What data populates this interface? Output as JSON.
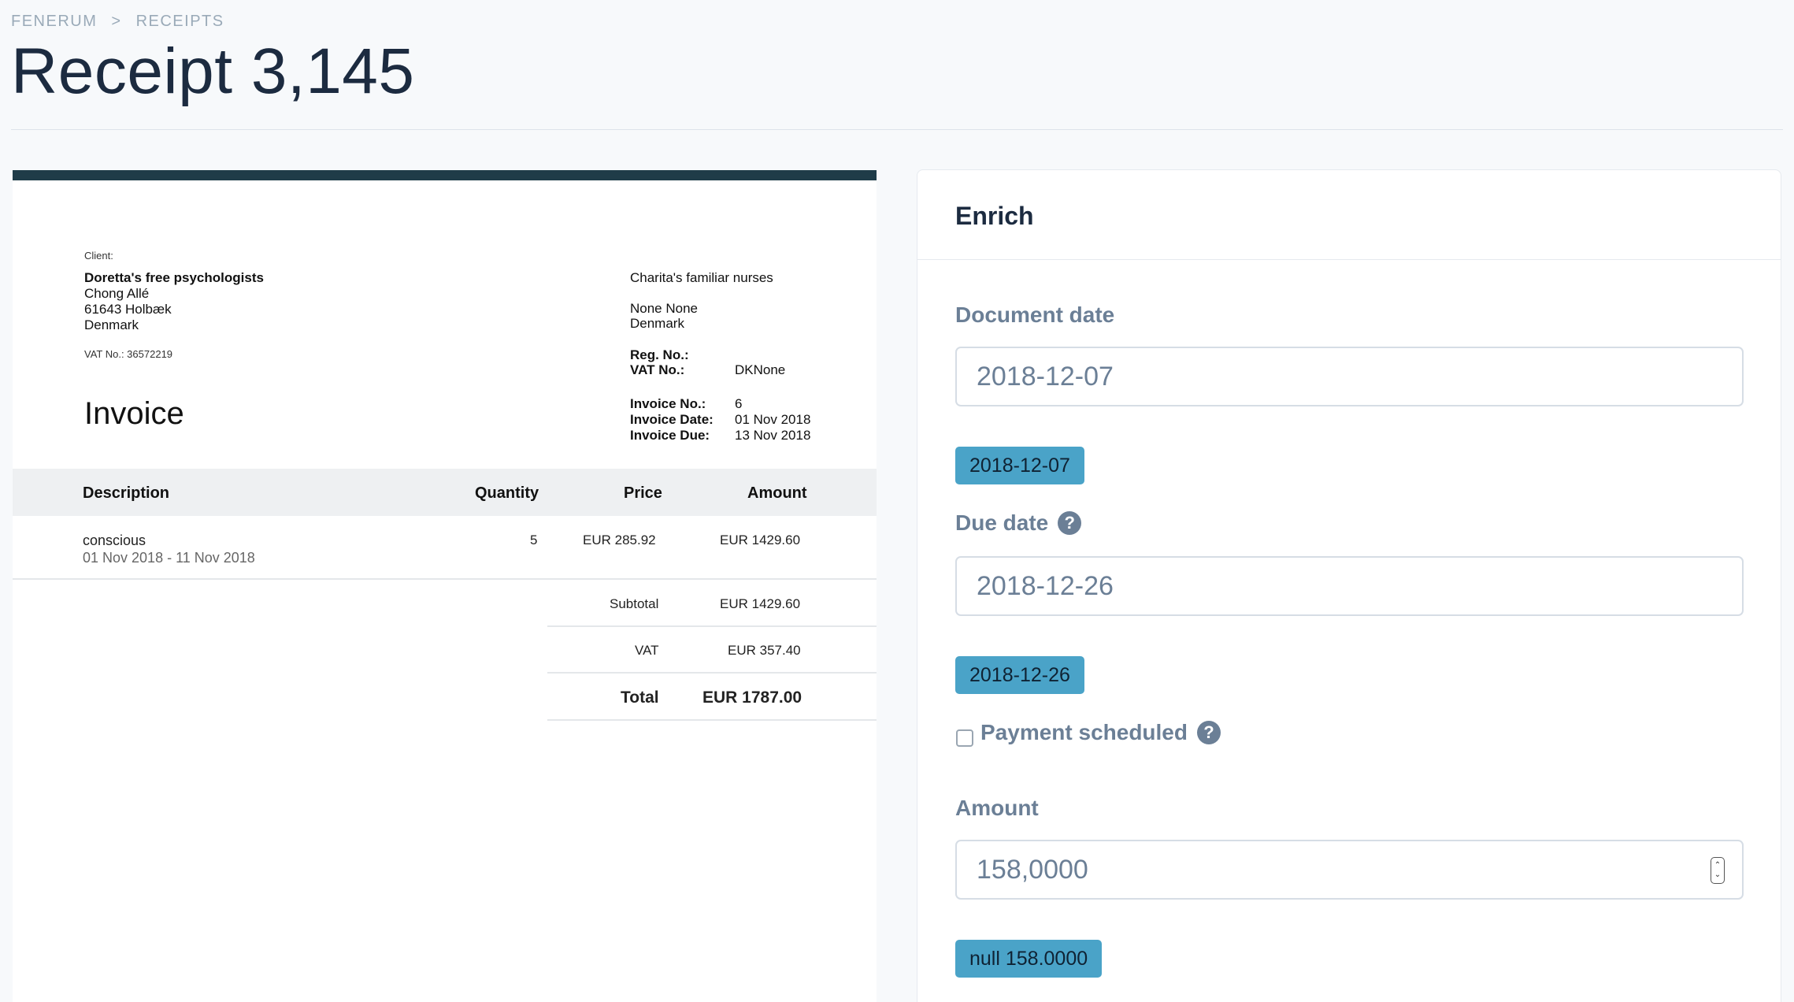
{
  "breadcrumb": {
    "root": "FENERUM",
    "separator": ">",
    "current": "RECEIPTS"
  },
  "page_title": "Receipt 3,145",
  "invoice": {
    "client_label": "Client:",
    "client": {
      "name": "Doretta's free psychologists",
      "street": "Chong Allé",
      "city": "61643 Holbæk",
      "country": "Denmark",
      "vat": "VAT No.: 36572219"
    },
    "sender": {
      "name": "Charita's familiar nurses",
      "line1": "None None",
      "country": "Denmark"
    },
    "reg_label": "Reg. No.:",
    "vat_label": "VAT No.:",
    "vat_value": "DKNone",
    "heading": "Invoice",
    "invoice_no_label": "Invoice No.:",
    "invoice_no": "6",
    "invoice_date_label": "Invoice Date:",
    "invoice_date": "01 Nov 2018",
    "invoice_due_label": "Invoice Due:",
    "invoice_due": "13 Nov 2018",
    "columns": {
      "description": "Description",
      "quantity": "Quantity",
      "price": "Price",
      "amount": "Amount"
    },
    "line": {
      "description": "conscious",
      "period": "01 Nov 2018 - 11 Nov 2018",
      "quantity": "5",
      "price": "EUR 285.92",
      "amount": "EUR 1429.60"
    },
    "subtotal_label": "Subtotal",
    "subtotal": "EUR 1429.60",
    "vat_total_label": "VAT",
    "vat_total": "EUR 357.40",
    "total_label": "Total",
    "total": "EUR 1787.00"
  },
  "enrich": {
    "title": "Enrich",
    "document_date_label": "Document date",
    "document_date_value": "2018-12-07",
    "document_date_chip": "2018-12-07",
    "due_date_label": "Due date",
    "due_date_value": "2018-12-26",
    "due_date_chip": "2018-12-26",
    "payment_scheduled_label": "Payment scheduled",
    "payment_scheduled": false,
    "amount_label": "Amount",
    "amount_value": "158,0000",
    "amount_chip": "null 158.0000",
    "help_glyph": "?"
  },
  "colors": {
    "chip": "#4aa3c8",
    "invoice_bar": "#1f3c48",
    "label": "#6b7f96"
  }
}
